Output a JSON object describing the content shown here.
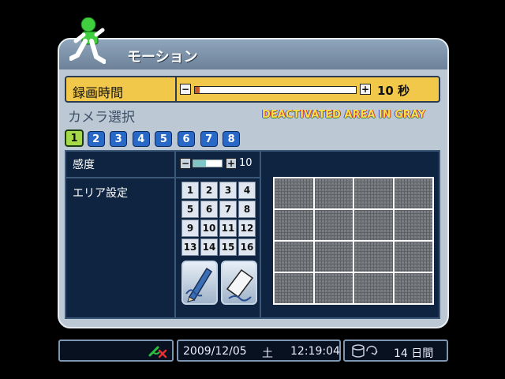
{
  "window": {
    "title": "モーション"
  },
  "record": {
    "label": "録画時間",
    "value_text": "10 秒",
    "level": 0.03,
    "minus": "−",
    "plus": "+"
  },
  "camera_select": {
    "label": "カメラ選択",
    "notice": "DEACTIVATED AREA IN GRAY"
  },
  "cameras": [
    "1",
    "2",
    "3",
    "4",
    "5",
    "6",
    "7",
    "8"
  ],
  "active_camera": "1",
  "sensitivity": {
    "label": "感度",
    "value": "10",
    "level": 0.45,
    "minus": "−",
    "plus": "+"
  },
  "area": {
    "label": "エリア設定",
    "cells": [
      "1",
      "2",
      "3",
      "4",
      "5",
      "6",
      "7",
      "8",
      "9",
      "10",
      "11",
      "12",
      "13",
      "14",
      "15",
      "16"
    ]
  },
  "tools": [
    "pencil-icon",
    "eraser-icon"
  ],
  "status": {
    "date": "2009/12/05",
    "weekday": "土",
    "time": "12:19:04",
    "days": "14 日間"
  },
  "colors": {
    "accent": "#f2c84a",
    "camera_active": "#a6d94a",
    "camera": "#2868c6",
    "panel": "#bcc9d5"
  }
}
